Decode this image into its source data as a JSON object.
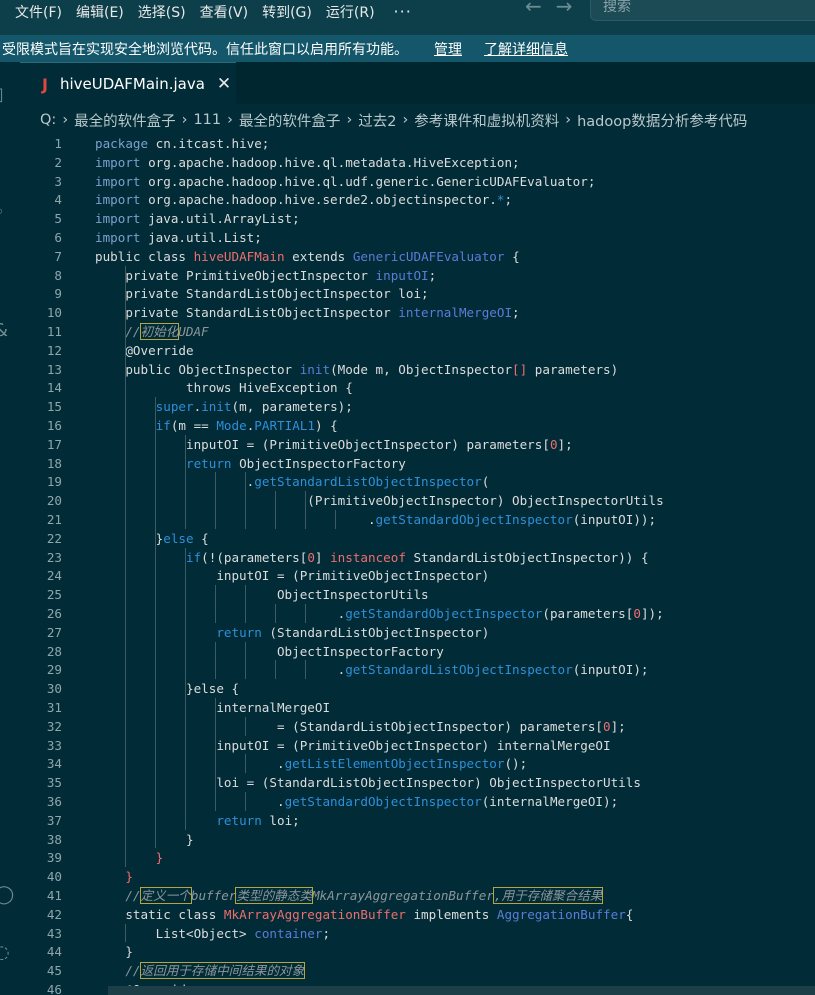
{
  "menubar": {
    "items": [
      "文件(F)",
      "编辑(E)",
      "选择(S)",
      "查看(V)",
      "转到(G)",
      "运行(R)"
    ],
    "more": "···",
    "search_placeholder": "搜索"
  },
  "banner": {
    "text": "受限模式旨在实现安全地浏览代码。信任此窗口以启用所有功能。",
    "manage": "管理",
    "learn_more": "了解详细信息"
  },
  "tab": {
    "icon": "J",
    "label": "hiveUDAFMain.java",
    "close": "✕"
  },
  "breadcrumb": [
    "Q:",
    "最全的软件盒子",
    "111",
    "最全的软件盒子",
    "过去2",
    "参考课件和虚拟机资料",
    "hadoop数据分析参考代码"
  ],
  "colors": {
    "bg": "#012b36",
    "banner": "#14566a",
    "menubar": "#0d3f4b"
  },
  "code_lines": [
    {
      "n": "1",
      "html": "<span class='pkg'>package</span> cn.itcast.hive;"
    },
    {
      "n": "2",
      "html": "<span class='pkg'>import</span> org.apache.hadoop.hive.ql.metadata.HiveException;"
    },
    {
      "n": "3",
      "html": "<span class='pkg'>import</span> org.apache.hadoop.hive.ql.udf.generic.GenericUDAFEvaluator;"
    },
    {
      "n": "4",
      "html": "<span class='pkg'>import</span> org.apache.hadoop.hive.serde2.objectinspector.<span class='fn'>*</span>;"
    },
    {
      "n": "5",
      "html": "<span class='pkg'>import</span> java.util.ArrayList;"
    },
    {
      "n": "6",
      "html": "<span class='pkg'>import</span> java.util.List;"
    },
    {
      "n": "7",
      "html": "public class <span class='str'>hiveUDAFMain</span> extends <span class='gen'>GenericUDAFEvaluator</span> {"
    },
    {
      "n": "8",
      "html": "    private PrimitiveObjectInspector <span class='gen'>inputOI</span>;"
    },
    {
      "n": "9",
      "html": "    private StandardListObjectInspector loi;"
    },
    {
      "n": "10",
      "html": "    private StandardListObjectInspector <span class='gen'>internalMergeOI</span>;"
    },
    {
      "n": "11",
      "html": "    <span class='cm'>//<span class='hl'>初始化</span>UDAF</span>"
    },
    {
      "n": "12",
      "html": "    @Override"
    },
    {
      "n": "13",
      "html": "    public ObjectInspector <span class='gen'>init</span>(Mode m, ObjectInspector<span class='str'>[]</span> parameters)"
    },
    {
      "n": "14",
      "html": "            throws HiveException {"
    },
    {
      "n": "15",
      "html": "        <span class='fn'>super</span>.<span class='fn'>init</span>(m, parameters);"
    },
    {
      "n": "16",
      "html": "        <span class='fn'>if</span>(m == <span class='fn'>Mode</span>.<span class='fn'>PARTIAL1</span>) {"
    },
    {
      "n": "17",
      "html": "            inputOI = (PrimitiveObjectInspector) parameters[<span class='num'>0</span>];"
    },
    {
      "n": "18",
      "html": "            <span class='fn'>return</span> ObjectInspectorFactory"
    },
    {
      "n": "19",
      "html": "                    .<span class='fn'>getStandardListObjectInspector</span>("
    },
    {
      "n": "20",
      "html": "                            (PrimitiveObjectInspector) ObjectInspectorUtils"
    },
    {
      "n": "21",
      "html": "                                    .<span class='fn'>getStandardObjectInspector</span>(inputOI));"
    },
    {
      "n": "22",
      "html": "        }<span class='fn'>else</span> {"
    },
    {
      "n": "23",
      "html": "            <span class='fn'>if</span>(!(parameters[<span class='num'>0</span>] <span class='str'>instanceof</span> StandardListObjectInspector)) {"
    },
    {
      "n": "24",
      "html": "                inputOI = (PrimitiveObjectInspector)"
    },
    {
      "n": "25",
      "html": "                        ObjectInspectorUtils"
    },
    {
      "n": "26",
      "html": "                                .<span class='fn'>getStandardObjectInspector</span>(parameters[<span class='num'>0</span>]);"
    },
    {
      "n": "27",
      "html": "                <span class='fn'>return</span> (StandardListObjectInspector)"
    },
    {
      "n": "28",
      "html": "                        ObjectInspectorFactory"
    },
    {
      "n": "29",
      "html": "                                .<span class='fn'>getStandardListObjectInspector</span>(inputOI);"
    },
    {
      "n": "30",
      "html": "            }else {"
    },
    {
      "n": "31",
      "html": "                internalMergeOI"
    },
    {
      "n": "32",
      "html": "                        = (StandardListObjectInspector) parameters[<span class='num'>0</span>];"
    },
    {
      "n": "33",
      "html": "                inputOI = (PrimitiveObjectInspector) internalMergeOI"
    },
    {
      "n": "34",
      "html": "                        .<span class='fn'>getListElementObjectInspector</span>();"
    },
    {
      "n": "35",
      "html": "                loi = (StandardListObjectInspector) ObjectInspectorUtils"
    },
    {
      "n": "36",
      "html": "                        .<span class='fn'>getStandardObjectInspector</span>(internalMergeOI);"
    },
    {
      "n": "37",
      "html": "                <span class='fn'>return</span> loi;"
    },
    {
      "n": "38",
      "html": "            }"
    },
    {
      "n": "39",
      "html": "        <span class='str'>}</span>"
    },
    {
      "n": "40",
      "html": "    <span class='str'>}</span>"
    },
    {
      "n": "41",
      "html": "    <span class='cm'>//<span class='hl'>定义一个</span>buffer<span class='hl'>类型的静态类</span>MkArrayAggregationBuffer<span class='hl'>,用于存储聚合结果</span></span>"
    },
    {
      "n": "42",
      "html": "    static class <span class='str'>MkArrayAggregationBuffer</span> implements <span class='gen'>AggregationBuffer</span>{"
    },
    {
      "n": "43",
      "html": "        List&lt;Object&gt; <span class='gen'>container</span>;"
    },
    {
      "n": "44",
      "html": "    }"
    },
    {
      "n": "45",
      "html": "    <span class='cm'>//<span class='hl'>返回用于存储中间结果的对象</span></span>"
    },
    {
      "n": "46",
      "html": "    @Override"
    }
  ]
}
